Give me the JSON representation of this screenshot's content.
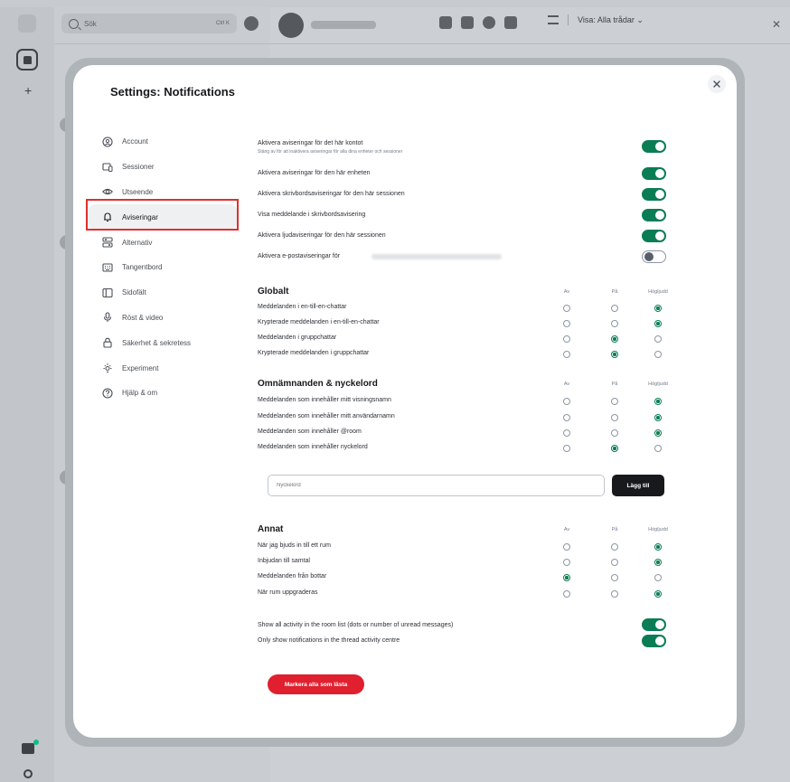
{
  "background": {
    "search_placeholder": "Sök",
    "search_shortcut": "Ctrl K",
    "thread_filter": "Visa: Alla trådar ⌄"
  },
  "modal": {
    "title_bold": "Settings:",
    "title_rest": " Notifications",
    "close_label": "×"
  },
  "nav": [
    {
      "label": "Account",
      "icon": "account-icon"
    },
    {
      "label": "Sessioner",
      "icon": "devices-icon"
    },
    {
      "label": "Utseende",
      "icon": "eye-icon"
    },
    {
      "label": "Aviseringar",
      "icon": "bell-icon"
    },
    {
      "label": "Alternativ",
      "icon": "preferences-icon"
    },
    {
      "label": "Tangentbord",
      "icon": "keyboard-icon"
    },
    {
      "label": "Sidofält",
      "icon": "sidebar-icon"
    },
    {
      "label": "Röst & video",
      "icon": "microphone-icon"
    },
    {
      "label": "Säkerhet & sekretess",
      "icon": "lock-icon"
    },
    {
      "label": "Experiment",
      "icon": "lab-icon"
    },
    {
      "label": "Hjälp & om",
      "icon": "help-icon"
    }
  ],
  "toggles": [
    {
      "label": "Aktivera aviseringar för det här kontot",
      "sub": "Stäng av för att inaktivera aviseringar för alla dina enheter och sessioner",
      "on": true
    },
    {
      "label": "Aktivera aviseringar för den här enheten",
      "on": true
    },
    {
      "label": "Aktivera skrivbordsaviseringar för den här sessionen",
      "on": true
    },
    {
      "label": "Visa meddelande i skrivbordsavisering",
      "on": true
    },
    {
      "label": "Aktivera ljudaviseringar för den här sessionen",
      "on": true
    },
    {
      "label": "Aktivera e-postaviseringar för",
      "on": false
    }
  ],
  "columns": {
    "off": "Av",
    "on": "På",
    "loud": "Högljudd"
  },
  "sections": [
    {
      "title": "Globalt",
      "rows": [
        {
          "label": "Meddelanden i en-till-en-chattar",
          "selected": "loud"
        },
        {
          "label": "Krypterade meddelanden i en-till-en-chattar",
          "selected": "loud"
        },
        {
          "label": "Meddelanden i gruppchattar",
          "selected": "on"
        },
        {
          "label": "Krypterade meddelanden i gruppchattar",
          "selected": "on"
        }
      ]
    },
    {
      "title": "Omnämnanden & nyckelord",
      "rows": [
        {
          "label": "Meddelanden som innehåller mitt visningsnamn",
          "selected": "loud"
        },
        {
          "label": "Meddelanden som innehåller mitt användarnamn",
          "selected": "loud"
        },
        {
          "label": "Meddelanden som innehåller @room",
          "selected": "loud"
        },
        {
          "label": "Meddelanden som innehåller nyckelord",
          "selected": "on"
        }
      ]
    },
    {
      "title": "Annat",
      "rows": [
        {
          "label": "När jag bjuds in till ett rum",
          "selected": "loud"
        },
        {
          "label": "Inbjudan till samtal",
          "selected": "loud"
        },
        {
          "label": "Meddelanden från bottar",
          "selected": "off"
        },
        {
          "label": "När rum uppgraderas",
          "selected": "loud"
        }
      ]
    }
  ],
  "keywords": {
    "placeholder": "Nyckelord",
    "add_label": "Lägg till"
  },
  "activity_toggles": [
    {
      "label": "Show all activity in the room list (dots or number of unread messages)",
      "on": true
    },
    {
      "label": "Only show notifications in the thread activity centre",
      "on": true
    }
  ],
  "mark_all_read": "Markera alla som lästa",
  "colors": {
    "accent": "#0b7d54",
    "danger": "#e0202f",
    "highlight_box": "#e02e2e"
  }
}
